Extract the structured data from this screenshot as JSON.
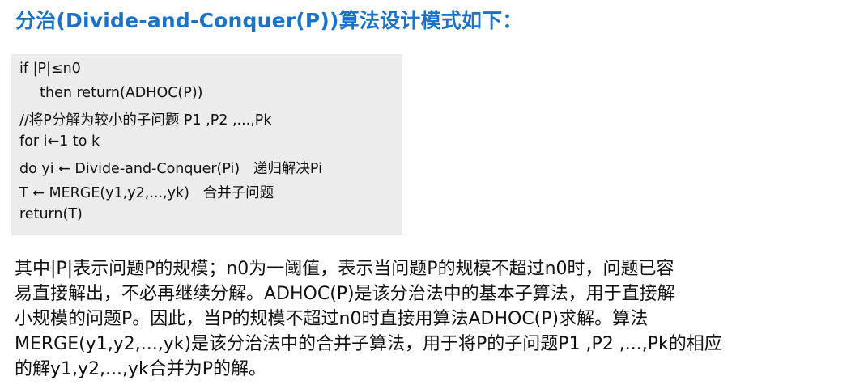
{
  "title": "分治(Divide-and-Conquer(P))算法设计模式如下：",
  "code": {
    "lines": [
      "if |P|≤n0",
      "  then return(ADHOC(P))",
      "//将P分解为较小的子问题 P1 ,P2 ,...,Pk",
      "for i←1 to k",
      "do yi ← Divide-and-Conquer(Pi)   递归解决Pi",
      "T ← MERGE(y1,y2,...,yk)   合并子问题",
      "return(T)"
    ]
  },
  "paragraph": {
    "lines": [
      "其中|P|表示问题P的规模；n0为一阈值，表示当问题P的规模不超过n0时，问题已容",
      "易直接解出，不必再继续分解。ADHOC(P)是该分治法中的基本子算法，用于直接解",
      "小规模的问题P。因此，当P的规模不超过n0时直接用算法ADHOC(P)求解。算法",
      "MERGE(y1,y2,...,yk)是该分治法中的合并子算法，用于将P的子问题P1 ,P2 ,...,Pk的相应",
      "的解y1,y2,...,yk合并为P的解。"
    ]
  }
}
